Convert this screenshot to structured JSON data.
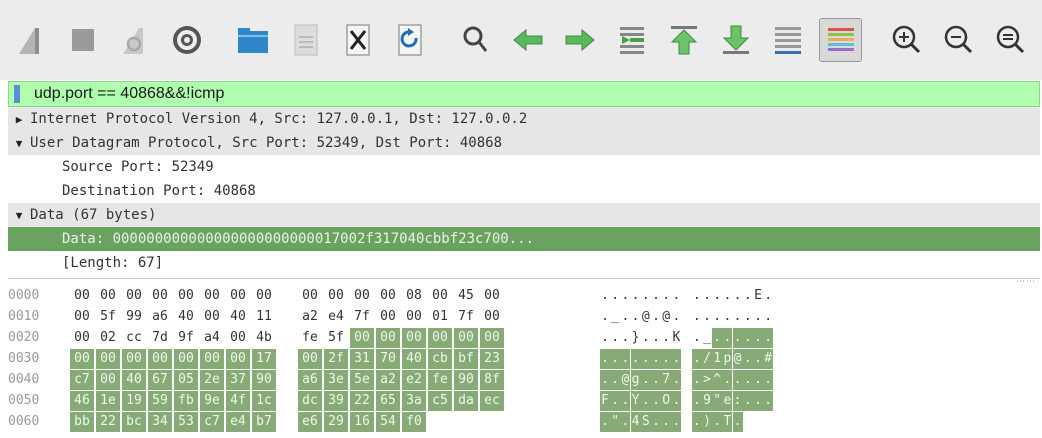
{
  "toolbar": {
    "icons": [
      "shark-fin-start-icon",
      "stop-icon",
      "restart-icon",
      "options-gear-icon",
      "open-folder-icon",
      "save-file-icon",
      "close-file-icon",
      "reload-icon",
      "find-icon",
      "back-arrow-icon",
      "forward-arrow-icon",
      "goto-packet-icon",
      "first-packet-icon",
      "last-packet-icon",
      "autoscroll-icon",
      "colorize-icon",
      "zoom-in-icon",
      "zoom-out-icon",
      "zoom-normal-icon"
    ]
  },
  "filter": {
    "text": "udp.port == 40868&&!icmp"
  },
  "details": [
    {
      "text": "Internet Protocol Version 4, Src: 127.0.0.1, Dst: 127.0.0.2",
      "state": "collapsed",
      "level": 0
    },
    {
      "text": "User Datagram Protocol, Src Port: 52349, Dst Port: 40868",
      "state": "expanded",
      "level": 0
    },
    {
      "text": "Source Port: 52349",
      "state": "none",
      "level": 1
    },
    {
      "text": "Destination Port: 40868",
      "state": "none",
      "level": 1
    },
    {
      "text": "Data (67 bytes)",
      "state": "expanded",
      "level": 0
    },
    {
      "text": "Data: 000000000000000000000000017002f317040cbbf23c700...",
      "state": "none",
      "level": 1,
      "selected": true
    },
    {
      "text": "[Length: 67]",
      "state": "none",
      "level": 1
    }
  ],
  "hex": [
    {
      "offset": "0000",
      "bytes": [
        "00",
        "00",
        "00",
        "00",
        "00",
        "00",
        "00",
        "00",
        "00",
        "00",
        "00",
        "00",
        "08",
        "00",
        "45",
        "00"
      ],
      "ascii": "........ ......E.",
      "hl_start": 16
    },
    {
      "offset": "0010",
      "bytes": [
        "00",
        "5f",
        "99",
        "a6",
        "40",
        "00",
        "40",
        "11",
        "a2",
        "e4",
        "7f",
        "00",
        "00",
        "01",
        "7f",
        "00"
      ],
      "ascii": "._..@.@. ........",
      "hl_start": 16
    },
    {
      "offset": "0020",
      "bytes": [
        "00",
        "02",
        "cc",
        "7d",
        "9f",
        "a4",
        "00",
        "4b",
        "fe",
        "5f",
        "00",
        "00",
        "00",
        "00",
        "00",
        "00"
      ],
      "ascii": "...}...K ._......",
      "hl_start": 10
    },
    {
      "offset": "0030",
      "bytes": [
        "00",
        "00",
        "00",
        "00",
        "00",
        "00",
        "00",
        "17",
        "00",
        "2f",
        "31",
        "70",
        "40",
        "cb",
        "bf",
        "23"
      ],
      "ascii": "........ ./1p@..#",
      "hl_start": 0
    },
    {
      "offset": "0040",
      "bytes": [
        "c7",
        "00",
        "40",
        "67",
        "05",
        "2e",
        "37",
        "90",
        "a6",
        "3e",
        "5e",
        "a2",
        "e2",
        "fe",
        "90",
        "8f"
      ],
      "ascii": "..@g..7. .>^.....",
      "hl_start": 0
    },
    {
      "offset": "0050",
      "bytes": [
        "46",
        "1e",
        "19",
        "59",
        "fb",
        "9e",
        "4f",
        "1c",
        "dc",
        "39",
        "22",
        "65",
        "3a",
        "c5",
        "da",
        "ec"
      ],
      "ascii": "F..Y..O. .9\"e:...",
      "hl_start": 0
    },
    {
      "offset": "0060",
      "bytes": [
        "bb",
        "22",
        "bc",
        "34",
        "53",
        "c7",
        "e4",
        "b7",
        "e6",
        "29",
        "16",
        "54",
        "f0"
      ],
      "ascii": ".\".4S... .).T.",
      "hl_start": 0
    }
  ],
  "colors": {
    "filter_bg": "#afffaf",
    "selected_row": "#6aa260",
    "hex_highlight": "#86ab76"
  }
}
